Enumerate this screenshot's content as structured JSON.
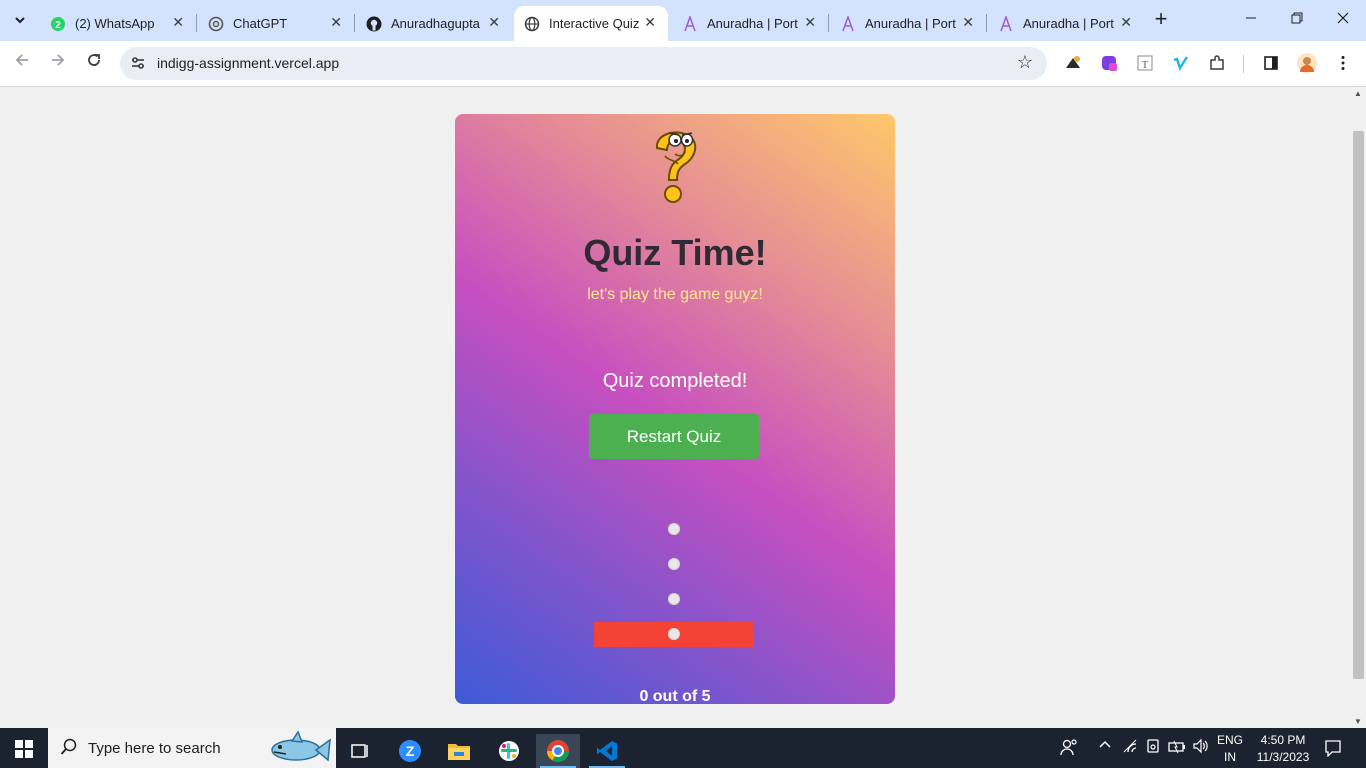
{
  "browser": {
    "tabs": [
      {
        "title": "(2) WhatsApp",
        "favicon": "whatsapp-icon",
        "active": false
      },
      {
        "title": "ChatGPT",
        "favicon": "chatgpt-icon",
        "active": false
      },
      {
        "title": "Anuradhagupta",
        "favicon": "github-icon",
        "active": false
      },
      {
        "title": "Interactive Quiz",
        "favicon": "globe-icon",
        "active": true
      },
      {
        "title": "Anuradha | Port",
        "favicon": "portfolio-a-icon",
        "active": false
      },
      {
        "title": "Anuradha | Port",
        "favicon": "portfolio-a-icon",
        "active": false
      },
      {
        "title": "Anuradha | Port",
        "favicon": "portfolio-a-icon",
        "active": false
      }
    ],
    "url": "indigg-assignment.vercel.app"
  },
  "quiz": {
    "title": "Quiz Time!",
    "subtitle": "let's play the game guyz!",
    "status": "Quiz completed!",
    "restart_label": "Restart Quiz",
    "options": [
      {
        "state": "neutral"
      },
      {
        "state": "neutral"
      },
      {
        "state": "neutral"
      },
      {
        "state": "incorrect"
      }
    ],
    "score": "0 out of 5",
    "colors": {
      "gradient": [
        "#3d5bd8",
        "#c74fc0",
        "#ffc86a"
      ],
      "button": "#4caf50",
      "incorrect": "#f44336",
      "title": "#2e2b35",
      "subtitle": "#ffe98f"
    }
  },
  "taskbar": {
    "search_placeholder": "Type here to search",
    "language_line1": "ENG",
    "language_line2": "IN",
    "time": "4:50 PM",
    "date": "11/3/2023"
  }
}
